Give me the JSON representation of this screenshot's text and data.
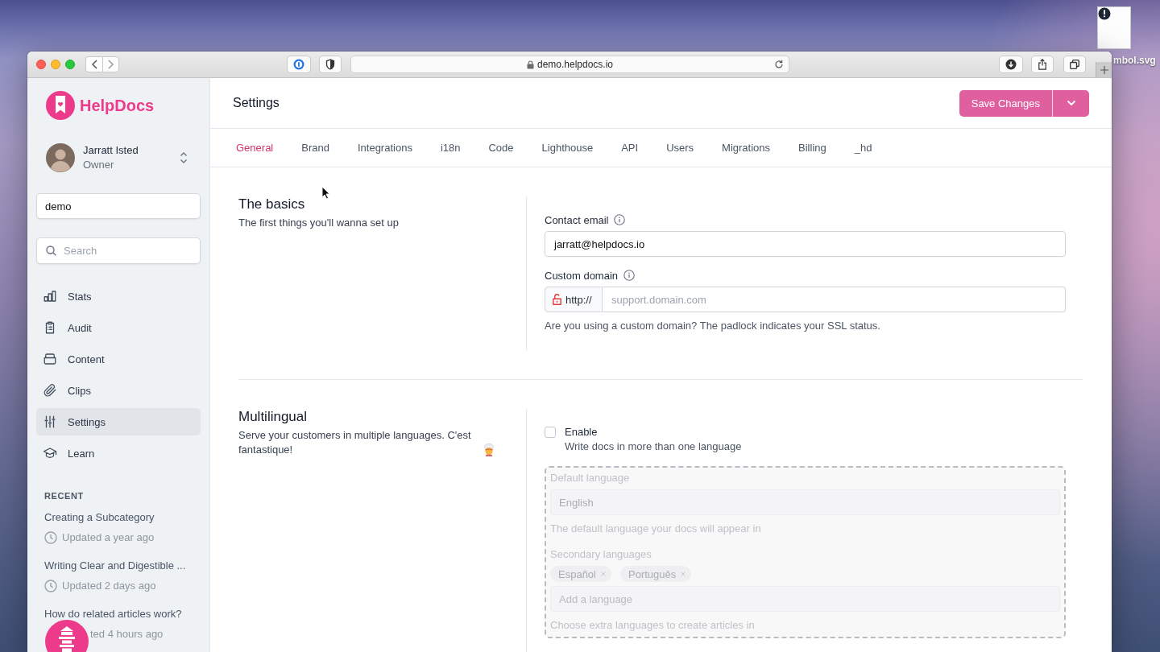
{
  "desktop": {
    "file_label": "mbol.svg"
  },
  "browser": {
    "url": "demo.helpdocs.io"
  },
  "sidebar": {
    "brand": "HelpDocs",
    "user": {
      "name": "Jarratt Isted",
      "role": "Owner"
    },
    "workspace_field": {
      "value": "demo"
    },
    "search": {
      "placeholder": "Search"
    },
    "nav": [
      {
        "label": "Stats",
        "selected": false
      },
      {
        "label": "Audit",
        "selected": false
      },
      {
        "label": "Content",
        "selected": false
      },
      {
        "label": "Clips",
        "selected": false
      },
      {
        "label": "Settings",
        "selected": true
      },
      {
        "label": "Learn",
        "selected": false
      }
    ],
    "recent": {
      "heading": "RECENT",
      "items": [
        {
          "title": "Creating a Subcategory",
          "updated": "Updated a year ago",
          "clock_icon": true
        },
        {
          "title": "Writing Clear and Digestible ...",
          "updated": "Updated 2 days ago",
          "clock_icon": true
        },
        {
          "title": "How do related articles work?",
          "updated": "ted 4 hours ago",
          "clock_icon": false
        }
      ]
    }
  },
  "header": {
    "title": "Settings",
    "save_button": {
      "label": "Save Changes",
      "disabled": true
    }
  },
  "tabs": [
    {
      "label": "General",
      "selected": true
    },
    {
      "label": "Brand",
      "selected": false
    },
    {
      "label": "Integrations",
      "selected": false
    },
    {
      "label": "i18n",
      "selected": false
    },
    {
      "label": "Code",
      "selected": false
    },
    {
      "label": "Lighthouse",
      "selected": false
    },
    {
      "label": "API",
      "selected": false
    },
    {
      "label": "Users",
      "selected": false
    },
    {
      "label": "Migrations",
      "selected": false
    },
    {
      "label": "Billing",
      "selected": false
    },
    {
      "label": "_hd",
      "selected": false
    }
  ],
  "basics": {
    "title": "The basics",
    "description": "The first things you'll wanna set up",
    "contact_email": {
      "label": "Contact email",
      "value": "jarratt@helpdocs.io"
    },
    "custom_domain": {
      "label": "Custom domain",
      "prefix": "http://",
      "placeholder": "support.domain.com",
      "secure": false,
      "help": "Are you using a custom domain? The padlock indicates your SSL status."
    }
  },
  "multilingual": {
    "title": "Multilingual",
    "description": "Serve your customers in multiple languages. C'est fantastique!",
    "enable": {
      "label": "Enable",
      "description": "Write docs in more than one language",
      "checked": false
    },
    "default_language": {
      "label": "Default language",
      "value": "English",
      "help": "The default language your docs will appear in"
    },
    "secondary_languages": {
      "label": "Secondary languages",
      "tags": [
        "Español",
        "Português"
      ],
      "placeholder": "Add a language",
      "help": "Choose extra languages to create articles in"
    }
  }
}
